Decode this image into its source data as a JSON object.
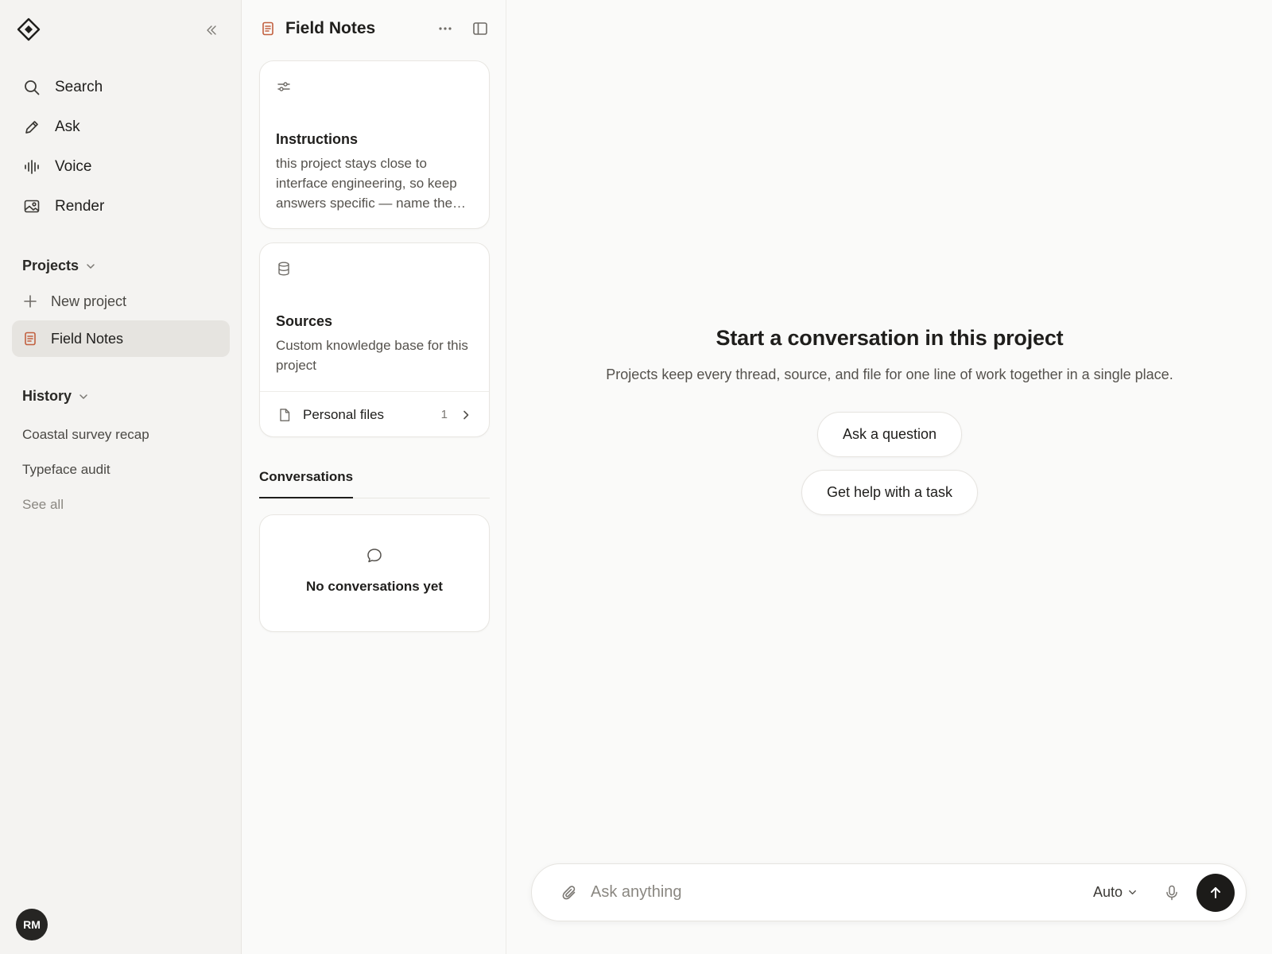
{
  "sidebar": {
    "nav": [
      {
        "label": "Search",
        "icon": "search-icon"
      },
      {
        "label": "Ask",
        "icon": "pencil-icon"
      },
      {
        "label": "Voice",
        "icon": "waveform-icon"
      },
      {
        "label": "Render",
        "icon": "image-icon"
      }
    ],
    "projects_label": "Projects",
    "new_project_label": "New project",
    "active_project": "Field Notes",
    "history_label": "History",
    "history_items": [
      "Coastal survey recap",
      "Typeface audit"
    ],
    "see_all_label": "See all",
    "avatar_initials": "RM"
  },
  "project": {
    "title": "Field Notes",
    "instructions": {
      "title": "Instructions",
      "text": "this project stays close to interface engineering, so keep answers specific — name the component, the state, and the constraint."
    },
    "sources": {
      "title": "Sources",
      "text": "Custom knowledge base for this project",
      "personal_files_label": "Personal files",
      "personal_files_count": "1"
    },
    "conversations_tab": "Conversations",
    "empty_text": "No conversations yet"
  },
  "main": {
    "title": "Start a conversation in this project",
    "subtitle": "Projects keep every thread, source, and file for one line of work together in a single place.",
    "actions": [
      "Ask a question",
      "Get help with a task"
    ],
    "composer": {
      "placeholder": "Ask anything",
      "model": "Auto"
    }
  },
  "colors": {
    "accent_doc": "#c2603f",
    "sidebar_bg": "#f4f3f1",
    "active_item_bg": "#e6e4e0",
    "send_button": "#1c1b19"
  }
}
